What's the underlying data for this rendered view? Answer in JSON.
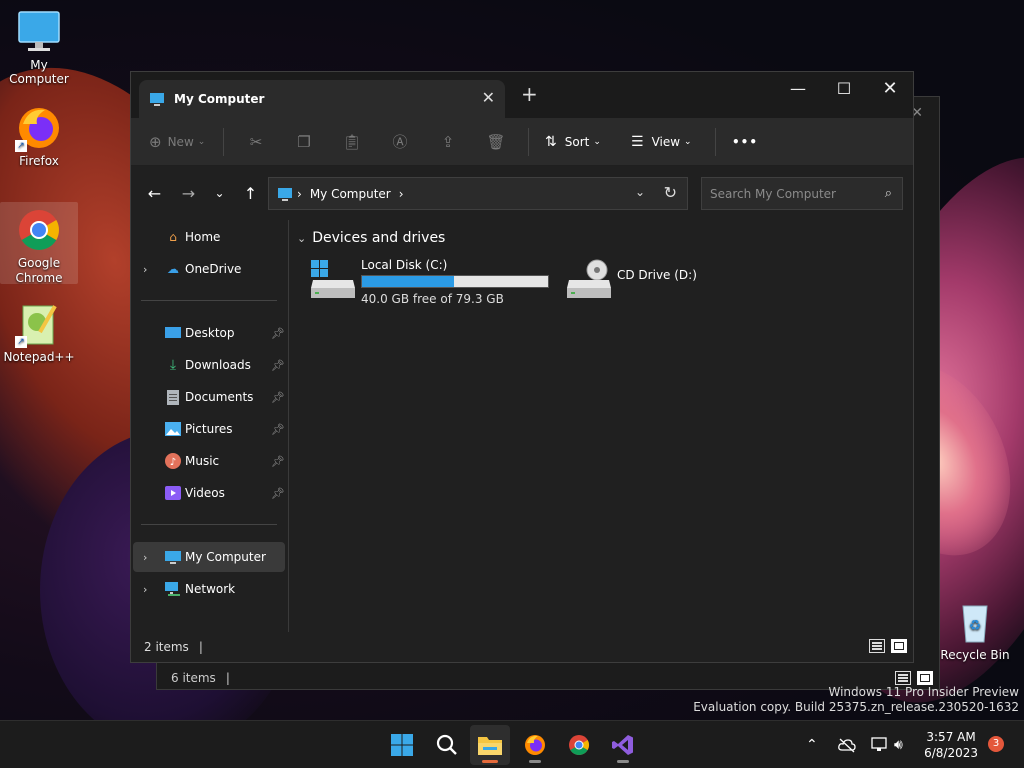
{
  "desktop": {
    "icons": [
      {
        "label": "My Computer",
        "icon": "monitor-icon"
      },
      {
        "label": "Firefox",
        "icon": "firefox-icon"
      },
      {
        "label": "Google Chrome",
        "icon": "chrome-icon"
      },
      {
        "label": "Notepad++",
        "icon": "notepadpp-icon"
      },
      {
        "label": "Recycle Bin",
        "icon": "recycle-bin-icon"
      }
    ]
  },
  "bg_window": {
    "status": "6 items"
  },
  "window": {
    "tab_title": "My Computer",
    "new_tab_glyph": "+",
    "controls": {
      "minimize": "—",
      "maximize": "☐",
      "close": "✕"
    },
    "commandbar": {
      "new_label": "New",
      "sort_label": "Sort",
      "view_label": "View",
      "more_glyph": "•••"
    },
    "address": {
      "crumbs": [
        "My Computer"
      ],
      "separator": "›"
    },
    "search": {
      "placeholder": "Search My Computer"
    },
    "sidebar": {
      "top": [
        {
          "label": "Home",
          "icon": "home-icon",
          "chevron": false
        },
        {
          "label": "OneDrive",
          "icon": "onedrive-icon",
          "chevron": true
        }
      ],
      "quick": [
        {
          "label": "Desktop",
          "icon": "desktop-folder-icon",
          "color": "#3aa0e8"
        },
        {
          "label": "Downloads",
          "icon": "downloads-icon",
          "color": "#3fbf7f"
        },
        {
          "label": "Documents",
          "icon": "documents-icon",
          "color": "#9aa0a6"
        },
        {
          "label": "Pictures",
          "icon": "pictures-icon",
          "color": "#4ab0f0"
        },
        {
          "label": "Music",
          "icon": "music-icon",
          "color": "#e2725b"
        },
        {
          "label": "Videos",
          "icon": "videos-icon",
          "color": "#8b5cf6"
        }
      ],
      "bottom": [
        {
          "label": "My Computer",
          "icon": "monitor-icon",
          "active": true
        },
        {
          "label": "Network",
          "icon": "network-icon",
          "active": false
        }
      ]
    },
    "content": {
      "group_title": "Devices and drives",
      "drives": [
        {
          "name": "Local Disk (C:)",
          "free_text": "40.0 GB free of 79.3 GB",
          "used_fraction": 0.4956,
          "icon": "windows-drive-icon"
        },
        {
          "name": "CD Drive (D:)",
          "icon": "cd-drive-icon"
        }
      ]
    },
    "status": {
      "items": "2 items",
      "caret": "|"
    }
  },
  "watermark": {
    "line1": "Windows 11 Pro Insider Preview",
    "line2": "Evaluation copy. Build 25375.zn_release.230520-1632"
  },
  "taskbar": {
    "clock_time": "3:57 AM",
    "clock_date": "6/8/2023",
    "notification_count": "3",
    "accent": "#e46a3b"
  }
}
